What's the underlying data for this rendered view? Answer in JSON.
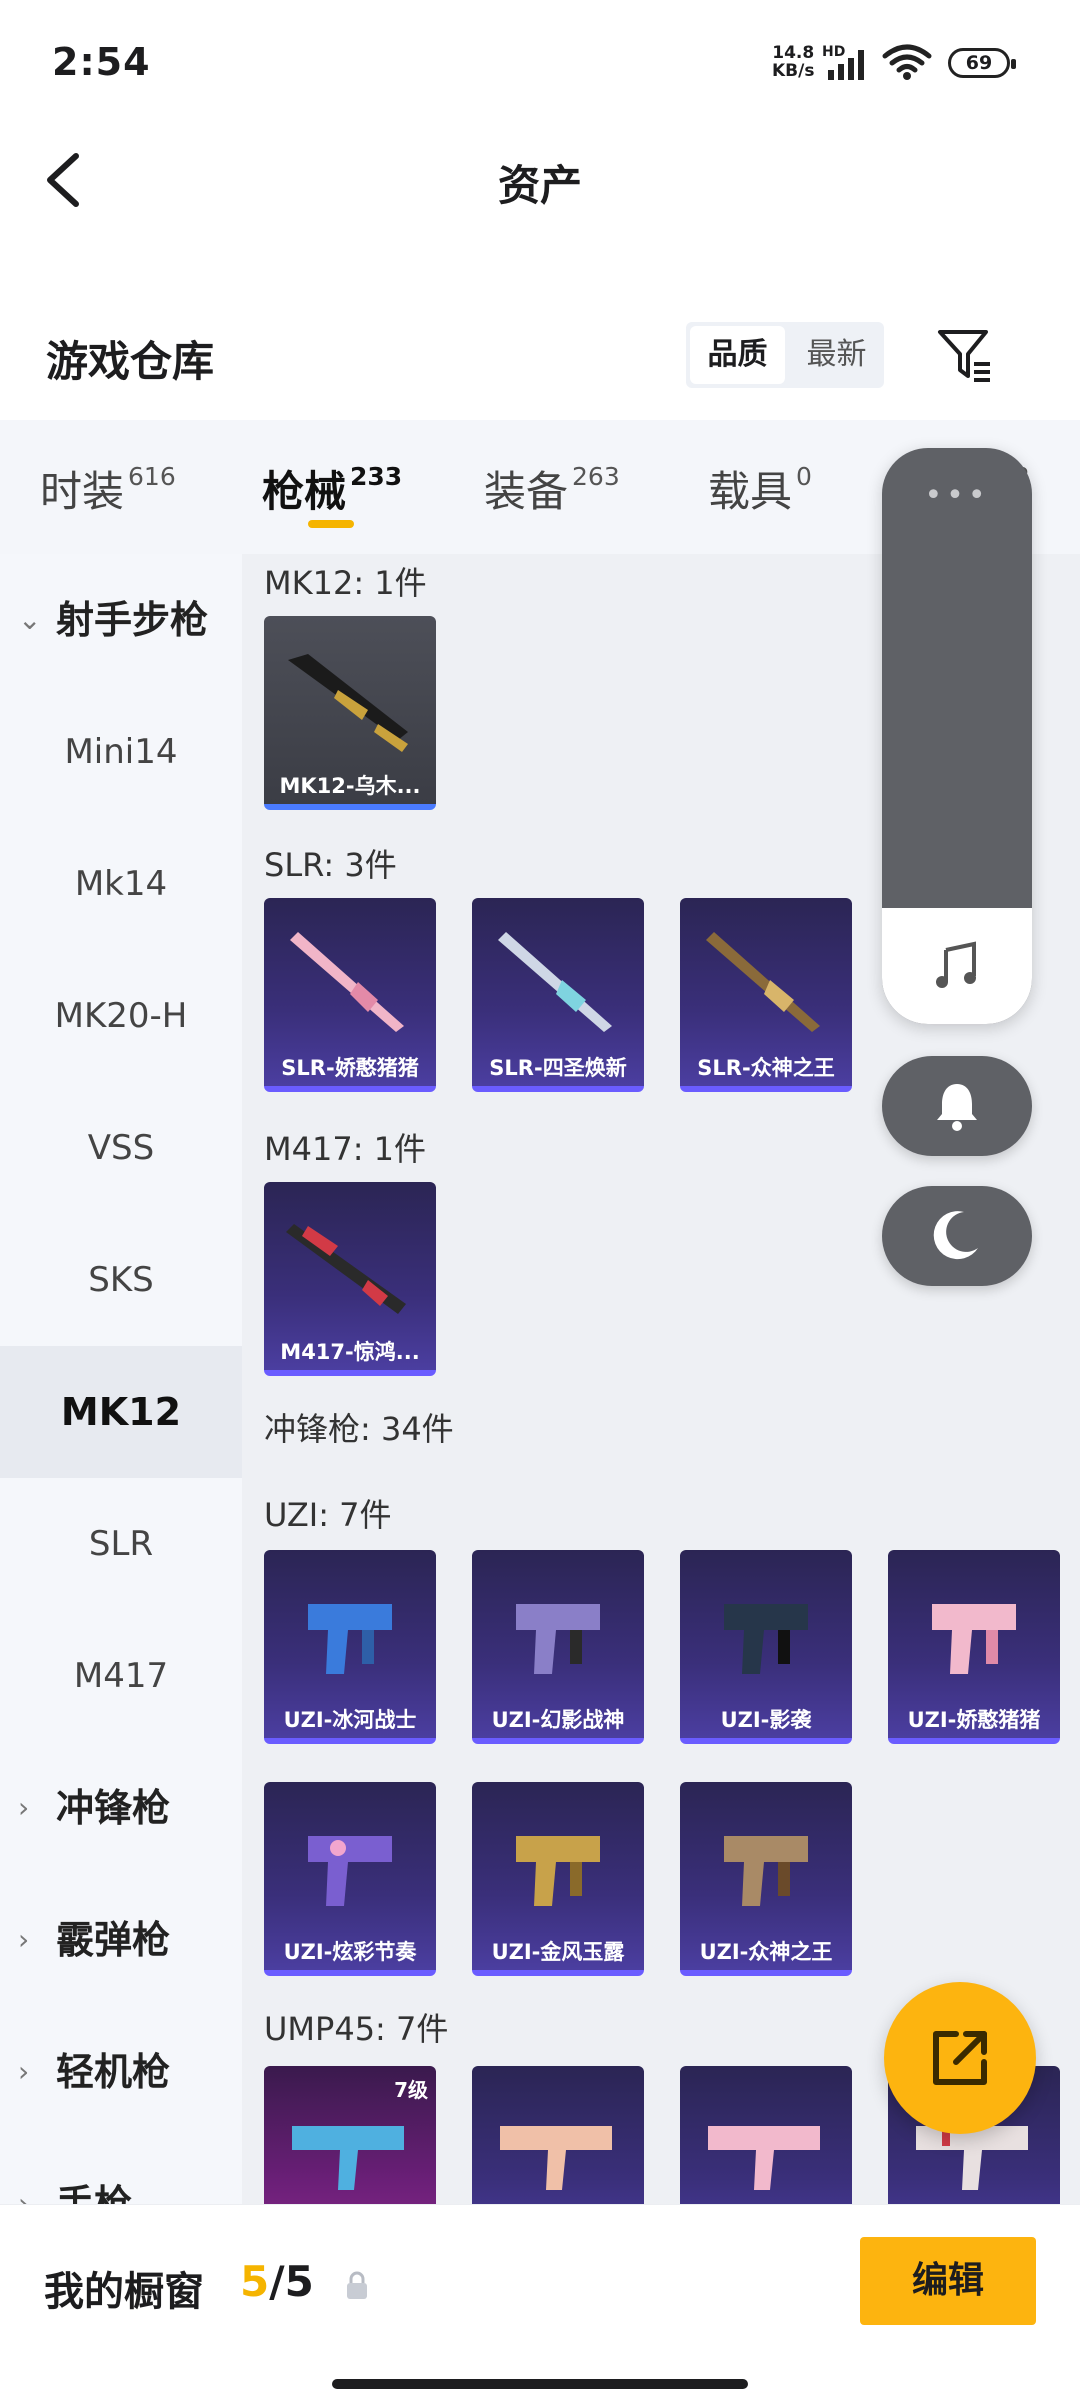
{
  "status_bar": {
    "time": "2:54",
    "net_speed": "14.8",
    "net_unit": "KB/s",
    "network_type": "HD",
    "battery": "69"
  },
  "header": {
    "title": "资产"
  },
  "warehouse": {
    "title": "游戏仓库",
    "sort_options": [
      "品质",
      "最新"
    ],
    "sort_selected": "品质"
  },
  "tabs": [
    {
      "label": "时装",
      "count": "616"
    },
    {
      "label": "枪械",
      "count": "233"
    },
    {
      "label": "装备",
      "count": "263"
    },
    {
      "label": "载具",
      "count": "0"
    },
    {
      "label": "",
      "count": "2"
    }
  ],
  "sidebar": {
    "category_expanded": "射手步枪",
    "items": [
      "Mini14",
      "Mk14",
      "MK20-H",
      "VSS",
      "SKS",
      "MK12",
      "SLR",
      "M417"
    ],
    "selected": "MK12",
    "collapsed_categories": [
      "冲锋枪",
      "霰弹枪",
      "轻机枪",
      "手枪"
    ]
  },
  "groups": {
    "mk12": {
      "label": "MK12: 1件",
      "items": [
        "MK12-乌木..."
      ]
    },
    "slr": {
      "label": "SLR: 3件",
      "items": [
        "SLR-娇憨猪猪",
        "SLR-四圣焕新",
        "SLR-众神之王"
      ]
    },
    "m417": {
      "label": "M417: 1件",
      "items": [
        "M417-惊鸿..."
      ]
    },
    "smg_header": "冲锋枪: 34件",
    "uzi": {
      "label": "UZI: 7件",
      "items": [
        "UZI-冰河战士",
        "UZI-幻影战神",
        "UZI-影袭",
        "UZI-娇憨猪猪",
        "UZI-炫彩节奏",
        "UZI-金风玉露",
        "UZI-众神之王"
      ]
    },
    "ump45": {
      "label": "UMP45: 7件",
      "first_item_level": "7级"
    }
  },
  "floating": {
    "dots": "•••",
    "icons": [
      "music-icon",
      "bell-icon",
      "moon-icon"
    ]
  },
  "bottom": {
    "showcase_label": "我的橱窗",
    "showcase_current": "5",
    "showcase_sep": "/",
    "showcase_total": "5",
    "edit_label": "编辑"
  },
  "colors": {
    "accent": "#fdb40f",
    "card_bg": "#3a2f7a",
    "panel": "#5f6166"
  }
}
